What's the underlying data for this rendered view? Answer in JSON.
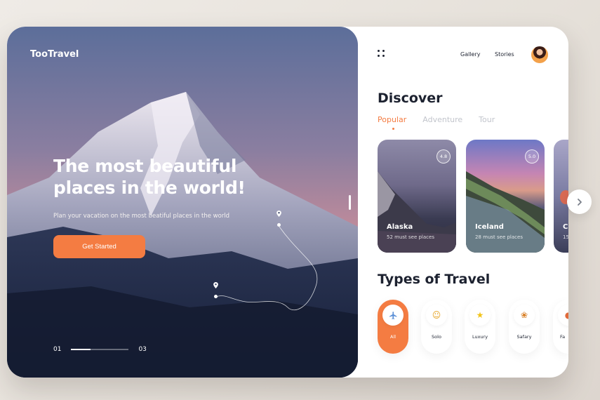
{
  "hero": {
    "brand": "TooTravel",
    "headline_line1": "The most beautiful",
    "headline_line2": "places in the world!",
    "subtitle": "Plan your vacation on the most beatiful places in the world",
    "cta_label": "Get Started",
    "pager_current": "01",
    "pager_total": "03",
    "pager_progress": 0.33
  },
  "header": {
    "nav": [
      "Gallery",
      "Stories"
    ],
    "menu_icon": "grid-dots-icon",
    "avatar_icon": "user-avatar"
  },
  "discover": {
    "title": "Discover",
    "tabs": [
      "Popular",
      "Adventure",
      "Tour"
    ],
    "active_tab": "Popular",
    "cards": [
      {
        "name": "Alaska",
        "subtitle": "52 must see places",
        "rating": "4.8"
      },
      {
        "name": "Iceland",
        "subtitle": "28 must see places",
        "rating": "5.0"
      },
      {
        "name": "C",
        "subtitle": "15",
        "rating": ""
      }
    ]
  },
  "types": {
    "title": "Types of Travel",
    "items": [
      {
        "label": "All",
        "icon": "airplane-icon",
        "active": true
      },
      {
        "label": "Solo",
        "icon": "face-icon",
        "active": false
      },
      {
        "label": "Luxury",
        "icon": "star-icon",
        "active": false
      },
      {
        "label": "Safary",
        "icon": "lion-icon",
        "active": false
      },
      {
        "label": "Fa",
        "icon": "family-icon",
        "active": false
      }
    ]
  },
  "next_button_icon": "chevron-right-icon",
  "colors": {
    "accent": "#f47c42",
    "dark": "#1d2230",
    "muted": "#c2c5cc"
  }
}
